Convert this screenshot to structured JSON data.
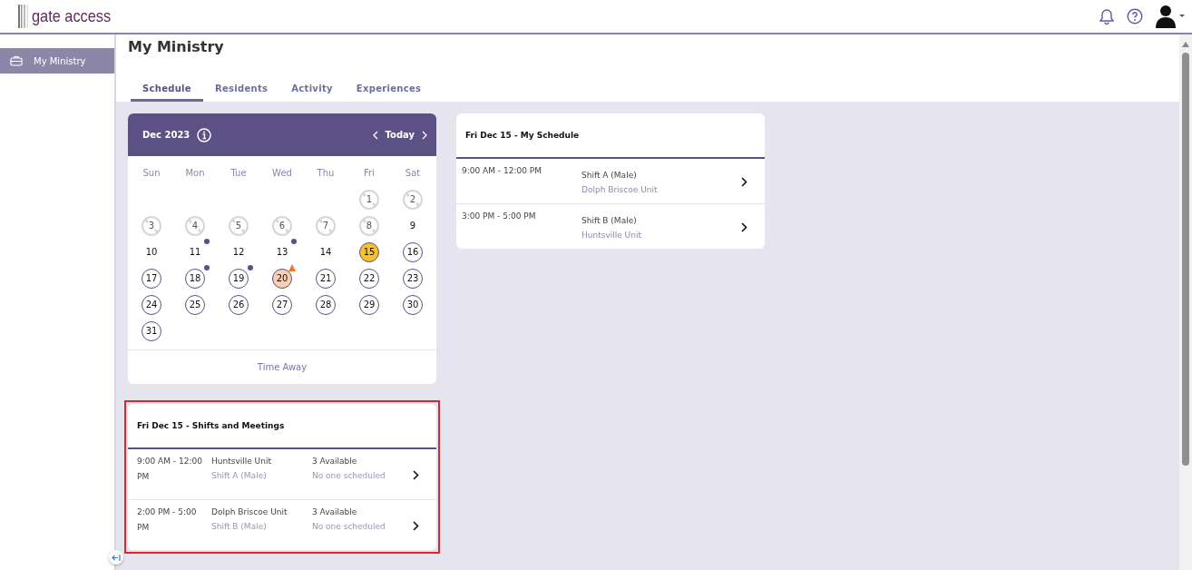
{
  "header": {
    "logo": "gate access"
  },
  "sidebar": {
    "items": [
      {
        "label": "My Ministry",
        "selected": true
      }
    ]
  },
  "page": {
    "title": "My Ministry"
  },
  "tabs": [
    {
      "label": "Schedule",
      "selected": true
    },
    {
      "label": "Residents",
      "selected": false
    },
    {
      "label": "Activity",
      "selected": false
    },
    {
      "label": "Experiences",
      "selected": false
    }
  ],
  "calendar": {
    "month": "Dec 2023",
    "today_label": "Today",
    "weekdays": [
      "Sun",
      "Mon",
      "Tue",
      "Wed",
      "Thu",
      "Fri",
      "Sat"
    ],
    "weeks": [
      [
        {
          "day": "1",
          "kind": "blocked",
          "dot": false,
          "warning": false
        },
        {
          "day": "2",
          "kind": "blocked",
          "dot": false,
          "warning": false
        }
      ],
      [
        {
          "day": "3",
          "kind": "blocked",
          "dot": false,
          "warning": false
        },
        {
          "day": "4",
          "kind": "blocked",
          "dot": false,
          "warning": false
        },
        {
          "day": "5",
          "kind": "blocked",
          "dot": false,
          "warning": false
        },
        {
          "day": "6",
          "kind": "blocked",
          "dot": false,
          "warning": false
        },
        {
          "day": "7",
          "kind": "blocked",
          "dot": false,
          "warning": false
        },
        {
          "day": "8",
          "kind": "blocked",
          "dot": false,
          "warning": false
        },
        {
          "day": "9",
          "kind": "plain",
          "dot": false,
          "warning": false
        }
      ],
      [
        {
          "day": "10",
          "kind": "plain",
          "dot": false,
          "warning": false
        },
        {
          "day": "11",
          "kind": "plain",
          "dot": true,
          "warning": false
        },
        {
          "day": "12",
          "kind": "plain",
          "dot": false,
          "warning": false
        },
        {
          "day": "13",
          "kind": "plain",
          "dot": true,
          "warning": false
        },
        {
          "day": "14",
          "kind": "plain",
          "dot": false,
          "warning": false
        },
        {
          "day": "15",
          "kind": "today",
          "dot": false,
          "warning": false
        },
        {
          "day": "16",
          "kind": "open",
          "dot": false,
          "warning": false
        }
      ],
      [
        {
          "day": "17",
          "kind": "open",
          "dot": false,
          "warning": false
        },
        {
          "day": "18",
          "kind": "open",
          "dot": true,
          "warning": false
        },
        {
          "day": "19",
          "kind": "open",
          "dot": true,
          "warning": false
        },
        {
          "day": "20",
          "kind": "flagged",
          "dot": false,
          "warning": true
        },
        {
          "day": "21",
          "kind": "open",
          "dot": false,
          "warning": false
        },
        {
          "day": "22",
          "kind": "open",
          "dot": false,
          "warning": false
        },
        {
          "day": "23",
          "kind": "open",
          "dot": false,
          "warning": false
        }
      ],
      [
        {
          "day": "24",
          "kind": "open",
          "dot": false,
          "warning": false
        },
        {
          "day": "25",
          "kind": "open",
          "dot": false,
          "warning": false
        },
        {
          "day": "26",
          "kind": "open",
          "dot": false,
          "warning": false
        },
        {
          "day": "27",
          "kind": "open",
          "dot": false,
          "warning": false
        },
        {
          "day": "28",
          "kind": "open",
          "dot": false,
          "warning": false
        },
        {
          "day": "29",
          "kind": "open",
          "dot": false,
          "warning": false
        },
        {
          "day": "30",
          "kind": "open",
          "dot": false,
          "warning": false
        }
      ],
      [
        {
          "day": "31",
          "kind": "open",
          "dot": false,
          "warning": false
        }
      ]
    ],
    "footer_link": "Time Away"
  },
  "my_schedule": {
    "title": "Fri Dec 15 - My Schedule",
    "rows": [
      {
        "time": "9:00 AM - 12:00 PM",
        "shift": "Shift A (Male)",
        "unit": "Dolph Briscoe Unit"
      },
      {
        "time": "3:00 PM - 5:00 PM",
        "shift": "Shift B (Male)",
        "unit": "Huntsville Unit"
      }
    ]
  },
  "shifts_meetings": {
    "title": "Fri Dec 15 - Shifts and Meetings",
    "highlighted": true,
    "rows": [
      {
        "time": "9:00 AM - 12:00 PM",
        "unit": "Huntsville Unit",
        "shift": "Shift A (Male)",
        "available": "3 Available",
        "scheduled": "No one scheduled"
      },
      {
        "time": "2:00 PM - 5:00 PM",
        "unit": "Dolph Briscoe Unit",
        "shift": "Shift B (Male)",
        "available": "3 Available",
        "scheduled": "No one scheduled"
      }
    ]
  }
}
